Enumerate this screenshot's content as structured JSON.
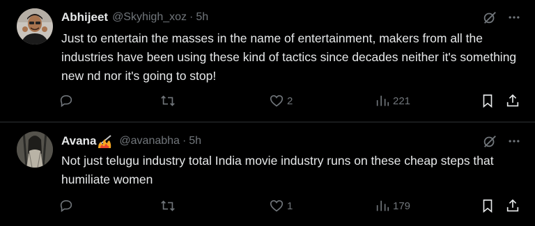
{
  "tweets": [
    {
      "author": "Abhijeet",
      "handle": "@Skyhigh_xoz",
      "separator": "·",
      "time": "5h",
      "text": "Just to entertain the masses in the name of entertainment, makers from all the industries have been using these kind of tactics since decades neither it's something new nd nor it's going to stop!",
      "likes": "2",
      "views": "221",
      "icons": [
        "grok-icon",
        "more-icon",
        "reply-icon",
        "retweet-icon",
        "like-icon",
        "views-icon",
        "bookmark-icon",
        "share-icon"
      ]
    },
    {
      "author": "Avana",
      "handle": "@avanabha",
      "separator": "·",
      "time": "5h",
      "text": "Not just telugu industry total India movie industry runs on these cheap steps that humiliate women",
      "likes": "1",
      "views": "179",
      "icons": [
        "grok-icon",
        "more-icon",
        "reply-icon",
        "retweet-icon",
        "like-icon",
        "views-icon",
        "bookmark-icon",
        "share-icon"
      ]
    }
  ],
  "colors": {
    "background": "#000000",
    "text": "#e7e9ea",
    "muted": "#71767b",
    "divider": "#2f3336"
  }
}
